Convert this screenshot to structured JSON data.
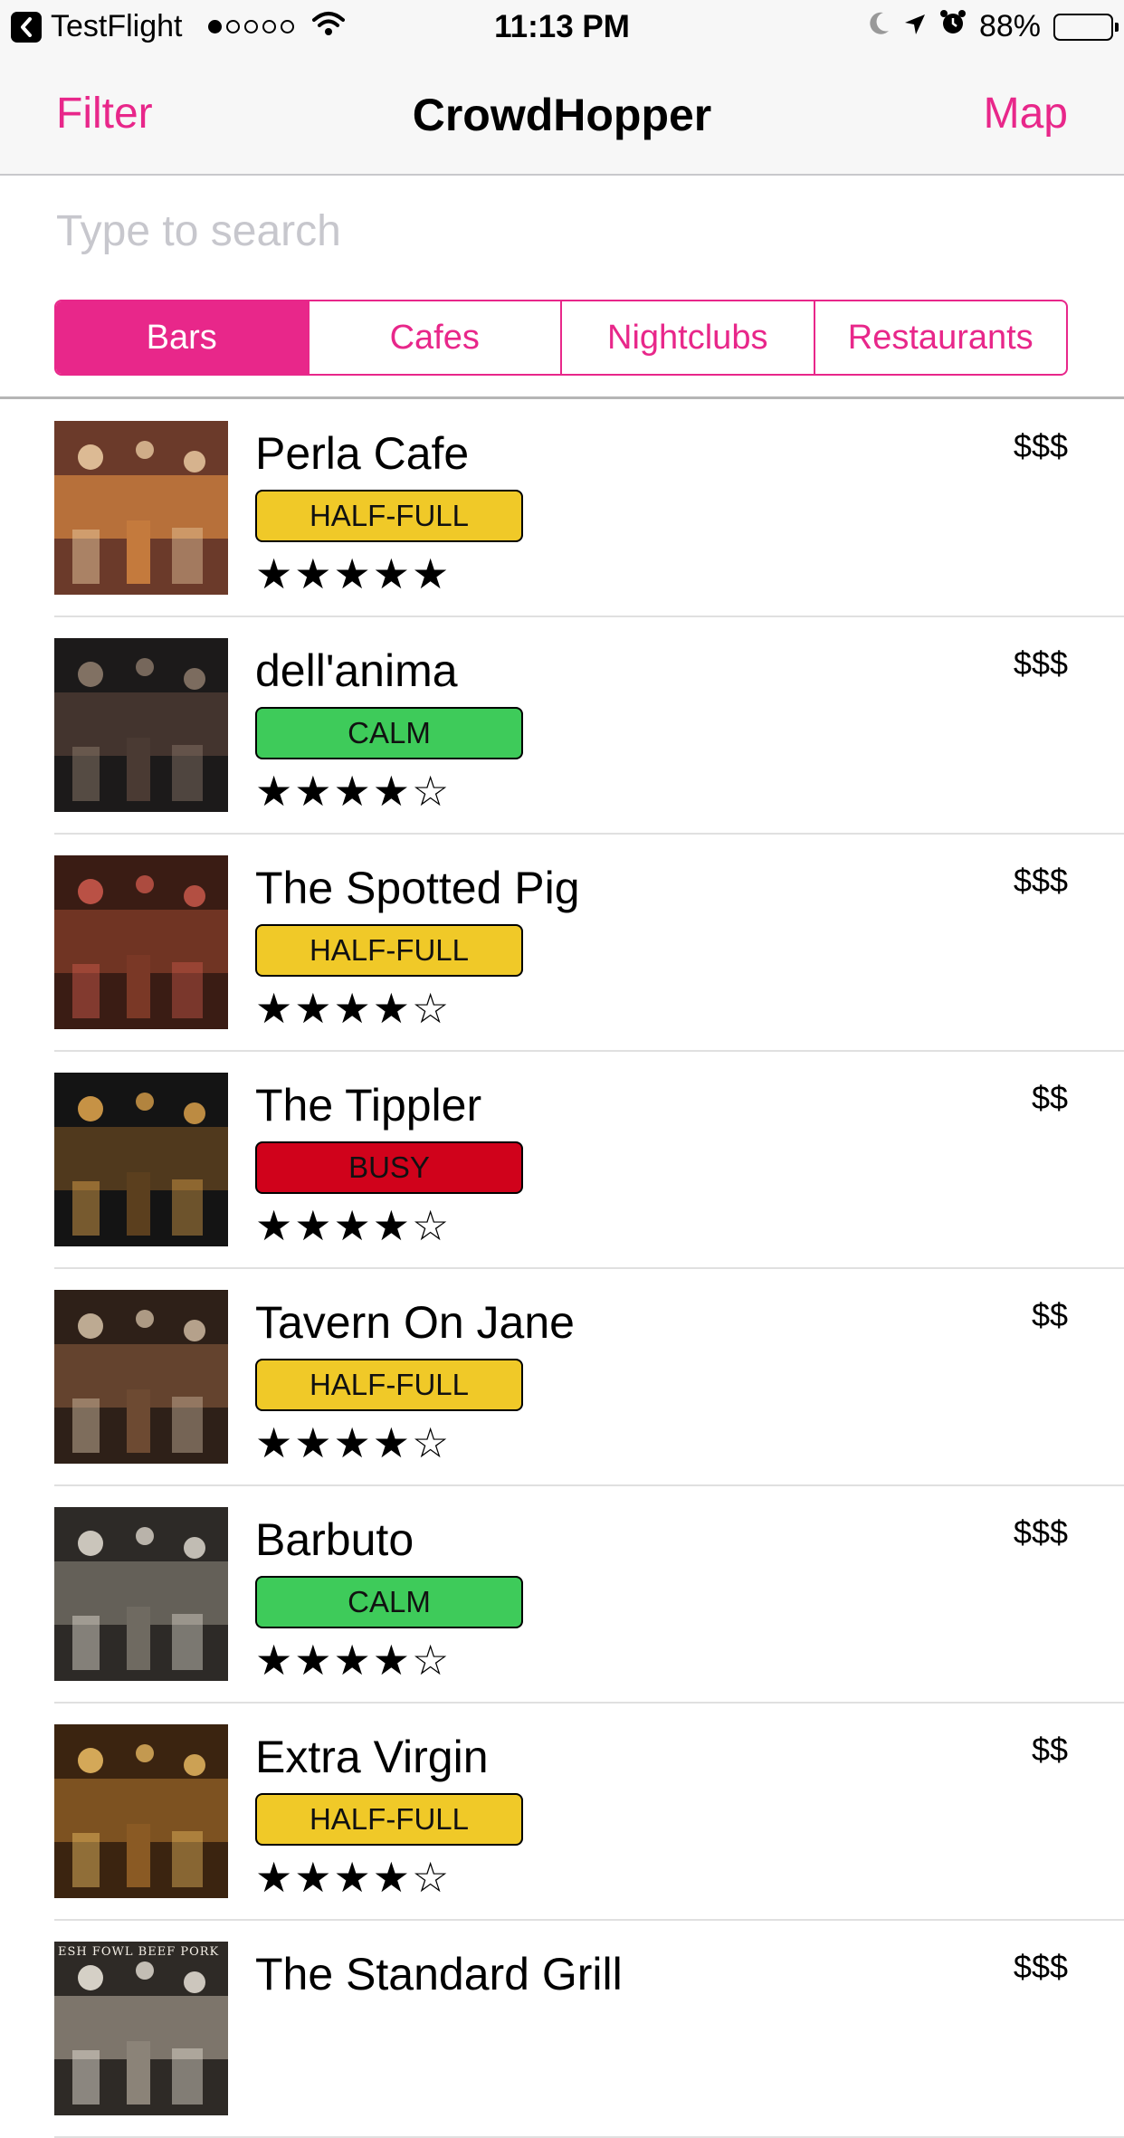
{
  "status_bar": {
    "app": "TestFlight",
    "time": "11:13 PM",
    "battery": "88%",
    "battery_level": 0.88,
    "signal_bars_filled": 1,
    "signal_bars_total": 5
  },
  "nav": {
    "left": "Filter",
    "title": "CrowdHopper",
    "right": "Map"
  },
  "search": {
    "placeholder": "Type to search",
    "value": ""
  },
  "tabs": [
    {
      "label": "Bars",
      "active": true
    },
    {
      "label": "Cafes",
      "active": false
    },
    {
      "label": "Nightclubs",
      "active": false
    },
    {
      "label": "Restaurants",
      "active": false
    }
  ],
  "colors": {
    "accent": "#e8278a",
    "half_full": "#f0c928",
    "calm": "#3ecb5a",
    "busy": "#d0021b"
  },
  "venues": [
    {
      "name": "Perla Cafe",
      "status": "HALF-FULL",
      "status_color": "#f0c928",
      "rating": 5,
      "stars": "★★★★★",
      "price": "$$$",
      "thumb": [
        "#6b3a2a",
        "#c47a3d",
        "#e9c9a0"
      ]
    },
    {
      "name": "dell'anima",
      "status": "CALM",
      "status_color": "#3ecb5a",
      "rating": 4,
      "stars": "★★★★☆",
      "price": "$$$",
      "thumb": [
        "#1c1a1a",
        "#4a3a33",
        "#8d7b6c"
      ]
    },
    {
      "name": "The Spotted Pig",
      "status": "HALF-FULL",
      "status_color": "#f0c928",
      "rating": 4,
      "stars": "★★★★☆",
      "price": "$$$",
      "thumb": [
        "#3a1c14",
        "#7a3826",
        "#c9584a"
      ]
    },
    {
      "name": "The Tippler",
      "status": "BUSY",
      "status_color": "#d0021b",
      "rating": 4,
      "stars": "★★★★☆",
      "price": "$$",
      "thumb": [
        "#141414",
        "#5b3f1e",
        "#d9a04a"
      ]
    },
    {
      "name": "Tavern On Jane",
      "status": "HALF-FULL",
      "status_color": "#f0c928",
      "rating": 4,
      "stars": "★★★★☆",
      "price": "$$",
      "thumb": [
        "#2e2018",
        "#6d4a32",
        "#cdb9a0"
      ]
    },
    {
      "name": "Barbuto",
      "status": "CALM",
      "status_color": "#3ecb5a",
      "rating": 4,
      "stars": "★★★★☆",
      "price": "$$$",
      "thumb": [
        "#2d2a27",
        "#6f6a61",
        "#dcd6cc"
      ]
    },
    {
      "name": "Extra Virgin",
      "status": "HALF-FULL",
      "status_color": "#f0c928",
      "rating": 4,
      "stars": "★★★★☆",
      "price": "$$",
      "thumb": [
        "#3b2410",
        "#8a5a24",
        "#e6b760"
      ]
    },
    {
      "name": "The Standard Grill",
      "status": "",
      "status_color": "#f0c928",
      "rating": 0,
      "stars": "",
      "price": "$$$",
      "thumb": [
        "#2e2a26",
        "#8b8378",
        "#e8e2d8"
      ],
      "thumb_text": "ESH FOWL BEEF PORK"
    }
  ]
}
